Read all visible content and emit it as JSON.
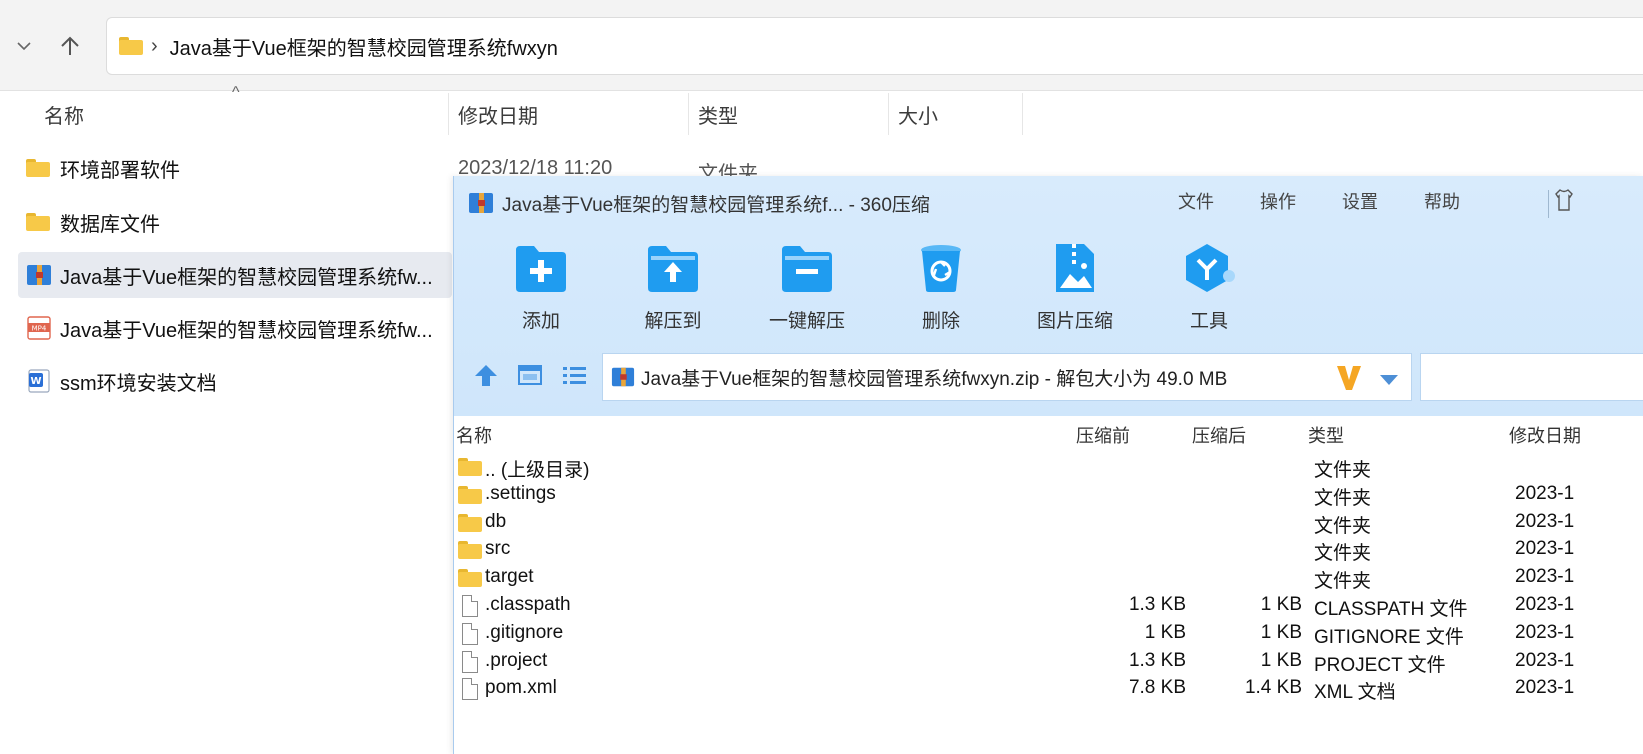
{
  "explorer": {
    "breadcrumb": "Java基于Vue框架的智慧校园管理系统fwxyn",
    "columns": {
      "name": "名称",
      "modified": "修改日期",
      "type": "类型",
      "size": "大小"
    },
    "rows": [
      {
        "name": "环境部署软件",
        "icon": "folder-icon"
      },
      {
        "name": "数据库文件",
        "icon": "folder-icon"
      },
      {
        "name": "Java基于Vue框架的智慧校园管理系统fw...",
        "icon": "zip-archive-icon"
      },
      {
        "name": "Java基于Vue框架的智慧校园管理系统fw...",
        "icon": "mp4-file-icon"
      },
      {
        "name": "ssm环境安装文档",
        "icon": "word-document-icon"
      }
    ],
    "row0_modified": "2023/12/18 11:20",
    "row0_type": "文件夹"
  },
  "zip": {
    "title": "Java基于Vue框架的智慧校园管理系统f... - 360压缩",
    "menu": [
      "文件",
      "操作",
      "设置",
      "帮助"
    ],
    "tools": [
      {
        "label": "添加",
        "icon": "add-icon"
      },
      {
        "label": "解压到",
        "icon": "extract-to-icon"
      },
      {
        "label": "一键解压",
        "icon": "one-click-extract-icon"
      },
      {
        "label": "删除",
        "icon": "delete-icon"
      },
      {
        "label": "图片压缩",
        "icon": "image-compress-icon"
      },
      {
        "label": "工具",
        "icon": "tools-icon"
      }
    ],
    "path": "Java基于Vue框架的智慧校园管理系统fwxyn.zip - 解包大小为 49.0 MB",
    "columns": {
      "name": "名称",
      "before": "压缩前",
      "after": "压缩后",
      "type": "类型",
      "modified": "修改日期"
    },
    "rows": [
      {
        "name": ".. (上级目录)",
        "before": "",
        "after": "",
        "type": "文件夹",
        "modified": "",
        "icon": "folder-icon"
      },
      {
        "name": ".settings",
        "before": "",
        "after": "",
        "type": "文件夹",
        "modified": "2023-1",
        "icon": "folder-icon"
      },
      {
        "name": "db",
        "before": "",
        "after": "",
        "type": "文件夹",
        "modified": "2023-1",
        "icon": "folder-icon"
      },
      {
        "name": "src",
        "before": "",
        "after": "",
        "type": "文件夹",
        "modified": "2023-1",
        "icon": "folder-icon"
      },
      {
        "name": "target",
        "before": "",
        "after": "",
        "type": "文件夹",
        "modified": "2023-1",
        "icon": "folder-icon"
      },
      {
        "name": ".classpath",
        "before": "1.3 KB",
        "after": "1 KB",
        "type": "CLASSPATH 文件",
        "modified": "2023-1",
        "icon": "file-icon"
      },
      {
        "name": ".gitignore",
        "before": "1 KB",
        "after": "1 KB",
        "type": "GITIGNORE 文件",
        "modified": "2023-1",
        "icon": "file-icon"
      },
      {
        "name": ".project",
        "before": "1.3 KB",
        "after": "1 KB",
        "type": "PROJECT 文件",
        "modified": "2023-1",
        "icon": "file-icon"
      },
      {
        "name": "pom.xml",
        "before": "7.8 KB",
        "after": "1.4 KB",
        "type": "XML 文档",
        "modified": "2023-1",
        "icon": "file-icon"
      }
    ]
  },
  "colors": {
    "accent": "#2f8ae6",
    "folder": "#f7c948",
    "zip_bg": "#d8ebfc"
  }
}
